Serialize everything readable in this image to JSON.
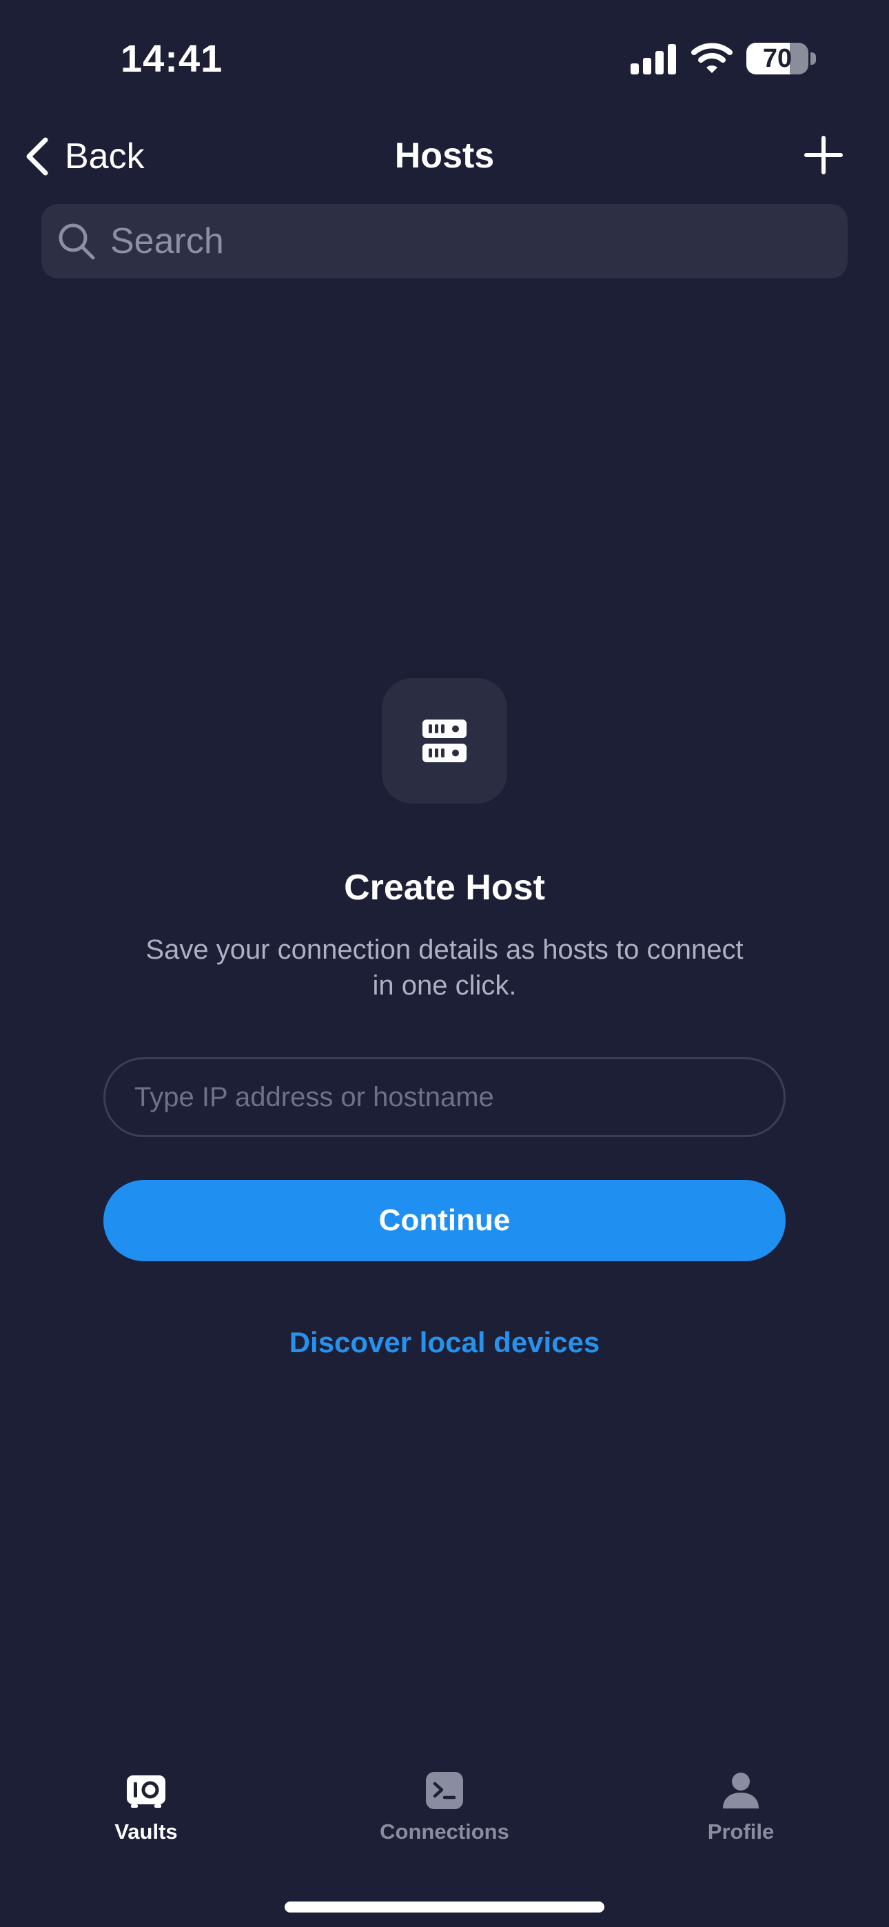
{
  "status_bar": {
    "time": "14:41",
    "battery_level": "70",
    "battery_fraction": 0.7
  },
  "nav": {
    "back_label": "Back",
    "title": "Hosts",
    "add_icon": "plus-icon"
  },
  "search": {
    "placeholder": "Search",
    "icon": "search-icon"
  },
  "empty_state": {
    "icon": "server-icon",
    "title": "Create Host",
    "subtitle": "Save your connection details as hosts to connect in one click.",
    "input_placeholder": "Type IP address or hostname",
    "continue_label": "Continue",
    "discover_label": "Discover local devices"
  },
  "tab_bar": {
    "active": "Vaults",
    "items": [
      {
        "label": "Vaults",
        "icon": "vault-icon"
      },
      {
        "label": "Connections",
        "icon": "terminal-icon"
      },
      {
        "label": "Profile",
        "icon": "person-icon"
      }
    ]
  },
  "colors": {
    "background": "#1c1f35",
    "accent": "#1f8ff2",
    "link": "#2692ee",
    "tab_inactive": "#8a8d9f",
    "tab_active": "#ffffff"
  }
}
